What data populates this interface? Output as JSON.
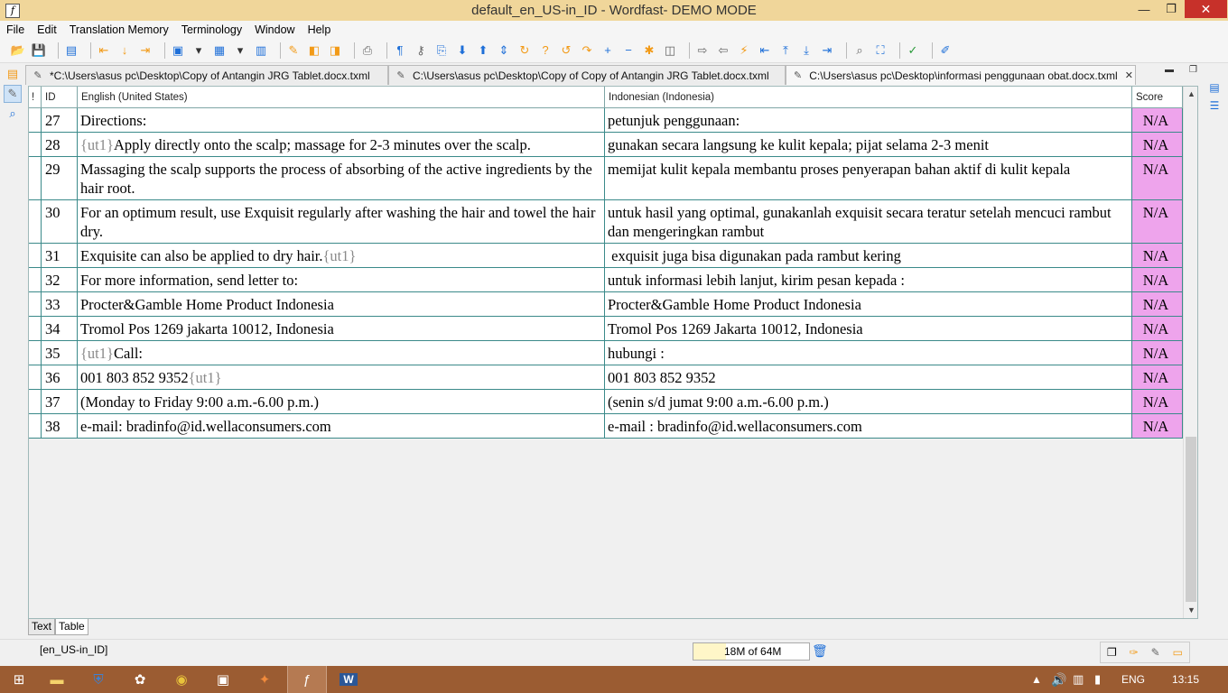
{
  "window": {
    "title": "default_en_US-in_ID - Wordfast- DEMO MODE",
    "app_icon": "wordfast-icon",
    "controls": {
      "minimize": "—",
      "maximize": "❐",
      "close": "✕"
    }
  },
  "menu": [
    "File",
    "Edit",
    "Translation Memory",
    "Terminology",
    "Window",
    "Help"
  ],
  "tabs": [
    {
      "label": "*C:\\Users\\asus pc\\Desktop\\Copy of Antangin JRG Tablet.docx.txml",
      "active": false
    },
    {
      "label": "C:\\Users\\asus pc\\Desktop\\Copy of Copy of Antangin JRG Tablet.docx.txml",
      "active": false
    },
    {
      "label": "C:\\Users\\asus pc\\Desktop\\informasi penggunaan obat.docx.txml",
      "active": true
    }
  ],
  "tab_close_glyph": "✕",
  "grid": {
    "headers": {
      "flag": "!",
      "id": "ID",
      "source": "English (United States)",
      "target": "Indonesian (Indonesia)",
      "score": "Score"
    },
    "rows": [
      {
        "id": "27",
        "src_pre": "",
        "src": "Directions:",
        "src_post": "",
        "tgt": "petunjuk penggunaan:",
        "score": "N/A"
      },
      {
        "id": "28",
        "src_pre": "{ut1}",
        "src": "Apply directly onto the scalp; massage for 2-3 minutes over the scalp.",
        "src_post": "",
        "tgt": "gunakan secara langsung ke kulit kepala; pijat selama 2-3 menit",
        "score": "N/A"
      },
      {
        "id": "29",
        "src_pre": "",
        "src": "Massaging the scalp supports the process of absorbing of the active ingredients by the hair root.",
        "src_post": "",
        "tgt": "memijat kulit kepala membantu proses penyerapan bahan aktif di kulit kepala",
        "score": "N/A"
      },
      {
        "id": "30",
        "src_pre": "",
        "src": "For an optimum result, use Exquisit regularly after washing the hair and towel the hair dry.",
        "src_post": "",
        "tgt": "untuk hasil yang optimal, gunakanlah exquisit secara teratur setelah mencuci rambut dan mengeringkan rambut",
        "score": "N/A"
      },
      {
        "id": "31",
        "src_pre": "",
        "src": "Exquisite can also be applied to dry hair.",
        "src_post": "{ut1}",
        "tgt": " exquisit juga bisa digunakan pada rambut kering",
        "score": "N/A"
      },
      {
        "id": "32",
        "src_pre": "",
        "src": "For more information, send letter to:",
        "src_post": "",
        "tgt": "untuk informasi lebih lanjut, kirim pesan kepada :",
        "score": "N/A"
      },
      {
        "id": "33",
        "src_pre": "",
        "src": "Procter&Gamble Home Product Indonesia",
        "src_post": "",
        "tgt": "Procter&Gamble Home Product Indonesia",
        "score": "N/A"
      },
      {
        "id": "34",
        "src_pre": "",
        "src": "Tromol Pos 1269 jakarta 10012, Indonesia",
        "src_post": "",
        "tgt": "Tromol Pos 1269 Jakarta 10012, Indonesia",
        "score": "N/A"
      },
      {
        "id": "35",
        "src_pre": "{ut1}",
        "src": "Call:",
        "src_post": "",
        "tgt": "hubungi :",
        "score": "N/A"
      },
      {
        "id": "36",
        "src_pre": "",
        "src": "001 803 852 9352",
        "src_post": "{ut1}",
        "tgt": "001 803 852 9352",
        "score": "N/A"
      },
      {
        "id": "37",
        "src_pre": "",
        "src": "(Monday to Friday 9:00 a.m.-6.00 p.m.)",
        "src_post": "",
        "tgt": "(senin s/d jumat 9:00 a.m.-6.00 p.m.)",
        "score": "N/A"
      },
      {
        "id": "38",
        "src_pre": "",
        "src": "e-mail: bradinfo@id.wellaconsumers.com",
        "src_post": "",
        "tgt": "e-mail : bradinfo@id.wellaconsumers.com",
        "score": "N/A"
      }
    ]
  },
  "view_tabs": [
    {
      "label": "Text",
      "active": false
    },
    {
      "label": "Table",
      "active": true
    }
  ],
  "status": {
    "language_pair": "[en_US-in_ID]",
    "memory_text": "18M of 64M",
    "memory_used_fraction": 0.28
  },
  "taskbar": {
    "input_language": "ENG",
    "clock": "13:15"
  },
  "colors": {
    "titlebar": "#f0d69a",
    "score_cell": "#eea4ec",
    "grid_border": "#3b8a8a",
    "taskbar": "#9b5c32",
    "close_button": "#c7312a"
  }
}
